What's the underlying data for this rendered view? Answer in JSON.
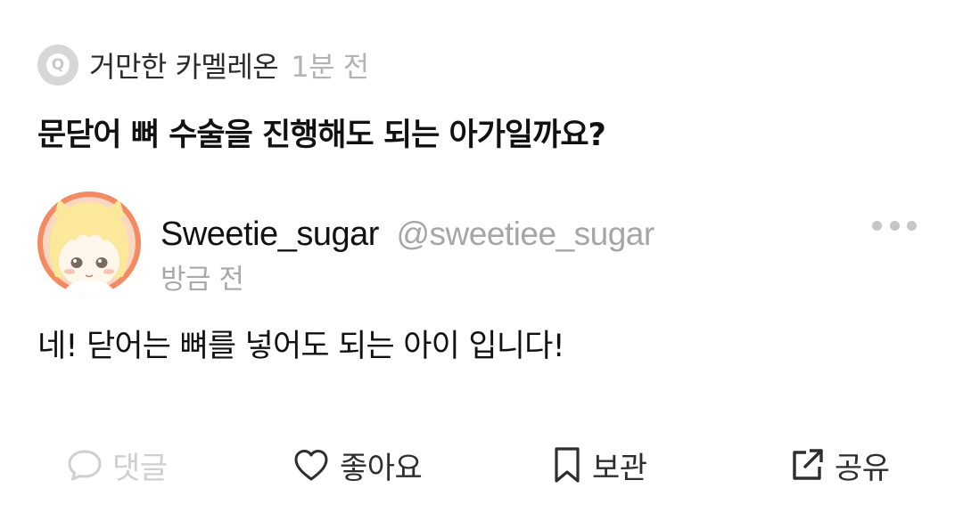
{
  "question": {
    "badge_letter": "Q",
    "author": "거만한 카멜레온",
    "time": "1분 전",
    "title": "문닫어 뼈 수술을 진행해도 되는 아가일까요?"
  },
  "reply": {
    "username": "Sweetie_sugar",
    "handle": "@sweetiee_sugar",
    "time": "방금 전",
    "body": "네! 닫어는 뼈를 넣어도 되는 아이 입니다!"
  },
  "actions": {
    "comment": {
      "label": "댓글",
      "icon": "speech-bubble-icon",
      "enabled": false
    },
    "like": {
      "label": "좋아요",
      "icon": "heart-outline-icon"
    },
    "save": {
      "label": "보관",
      "icon": "bookmark-icon"
    },
    "share": {
      "label": "공유",
      "icon": "external-share-icon"
    }
  },
  "colors": {
    "avatar_ring": "#f48a61",
    "avatar_hair": "#fbe89a",
    "muted_text": "#a9a9a9",
    "disabled": "#cfcfcf",
    "badge_bg": "#d7d7d7"
  }
}
